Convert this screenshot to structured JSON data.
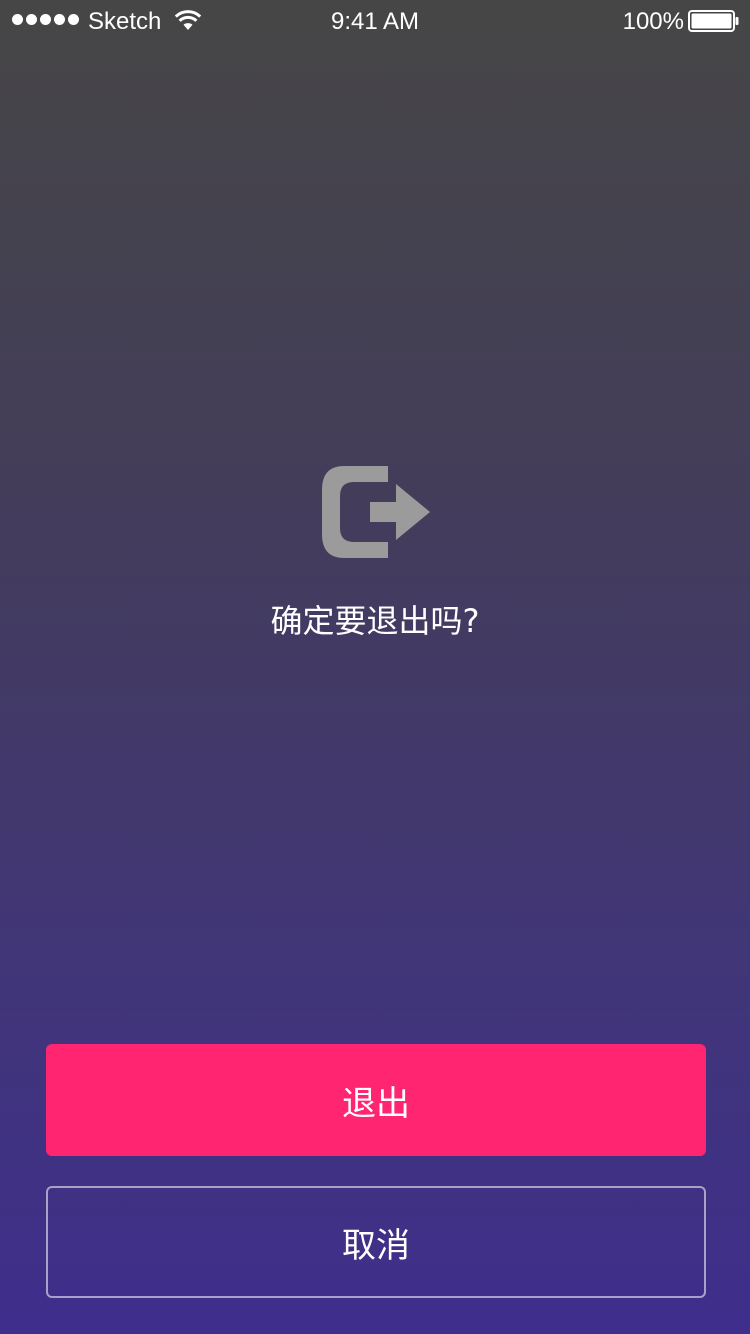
{
  "status_bar": {
    "carrier": "Sketch",
    "time": "9:41 AM",
    "battery_percent": "100%",
    "signal_icon": "signal-dots-icon",
    "wifi_icon": "wifi-icon",
    "battery_icon": "battery-icon",
    "battery_level": 1.0
  },
  "dialog": {
    "icon": "logout-icon",
    "icon_color": "#9b9b9b",
    "prompt": "确定要退出吗?"
  },
  "buttons": {
    "exit_label": "退出",
    "cancel_label": "取消",
    "exit_color": "#ff2570"
  },
  "colors": {
    "background_top": "#464646",
    "background_bottom": "#3f2e8c"
  }
}
